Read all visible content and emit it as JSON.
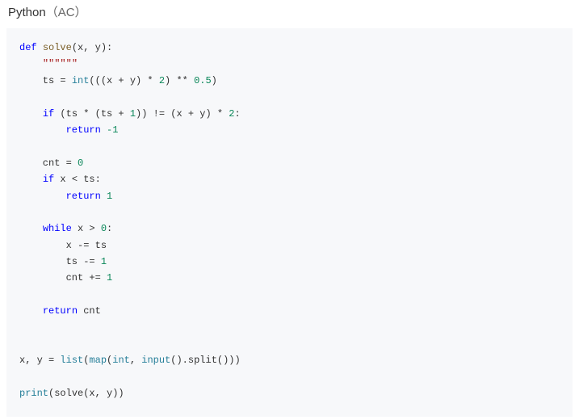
{
  "header": {
    "lang": "Python",
    "status": "（AC）"
  },
  "code": {
    "l1_def": "def",
    "l1_fn": "solve",
    "l1_rest": "(x, y):",
    "l2_doc": "\"\"\"\"\"\"",
    "l3_pre": "    ts = ",
    "l3_int": "int",
    "l3_paren1": "(((x + y) * ",
    "l3_n2": "2",
    "l3_mid": ") ** ",
    "l3_n05": "0.5",
    "l3_end": ")",
    "l5_if": "if",
    "l5_pre": " (ts * (ts + ",
    "l5_n1": "1",
    "l5_mid": ")) != (x + y) * ",
    "l5_n2b": "2",
    "l5_colon": ":",
    "l6_ret": "return",
    "l6_sp": " ",
    "l6_neg1": "-1",
    "l8_pre": "    cnt = ",
    "l8_n0": "0",
    "l9_if": "if",
    "l9_rest": " x < ts:",
    "l10_ret": "return",
    "l10_sp": " ",
    "l10_n1": "1",
    "l12_while": "while",
    "l12_pre": " x > ",
    "l12_n0": "0",
    "l12_colon": ":",
    "l13": "        x -= ts",
    "l14_pre": "        ts -= ",
    "l14_n1": "1",
    "l15_pre": "        cnt += ",
    "l15_n1": "1",
    "l17_ret": "return",
    "l17_rest": " cnt",
    "l20_pre": "x, y = ",
    "l20_list": "list",
    "l20_op1": "(",
    "l20_map": "map",
    "l20_op2": "(",
    "l20_int": "int",
    "l20_comma": ", ",
    "l20_input": "input",
    "l20_rest": "().split()))",
    "l22_print": "print",
    "l22_rest": "(solve(x, y))"
  }
}
